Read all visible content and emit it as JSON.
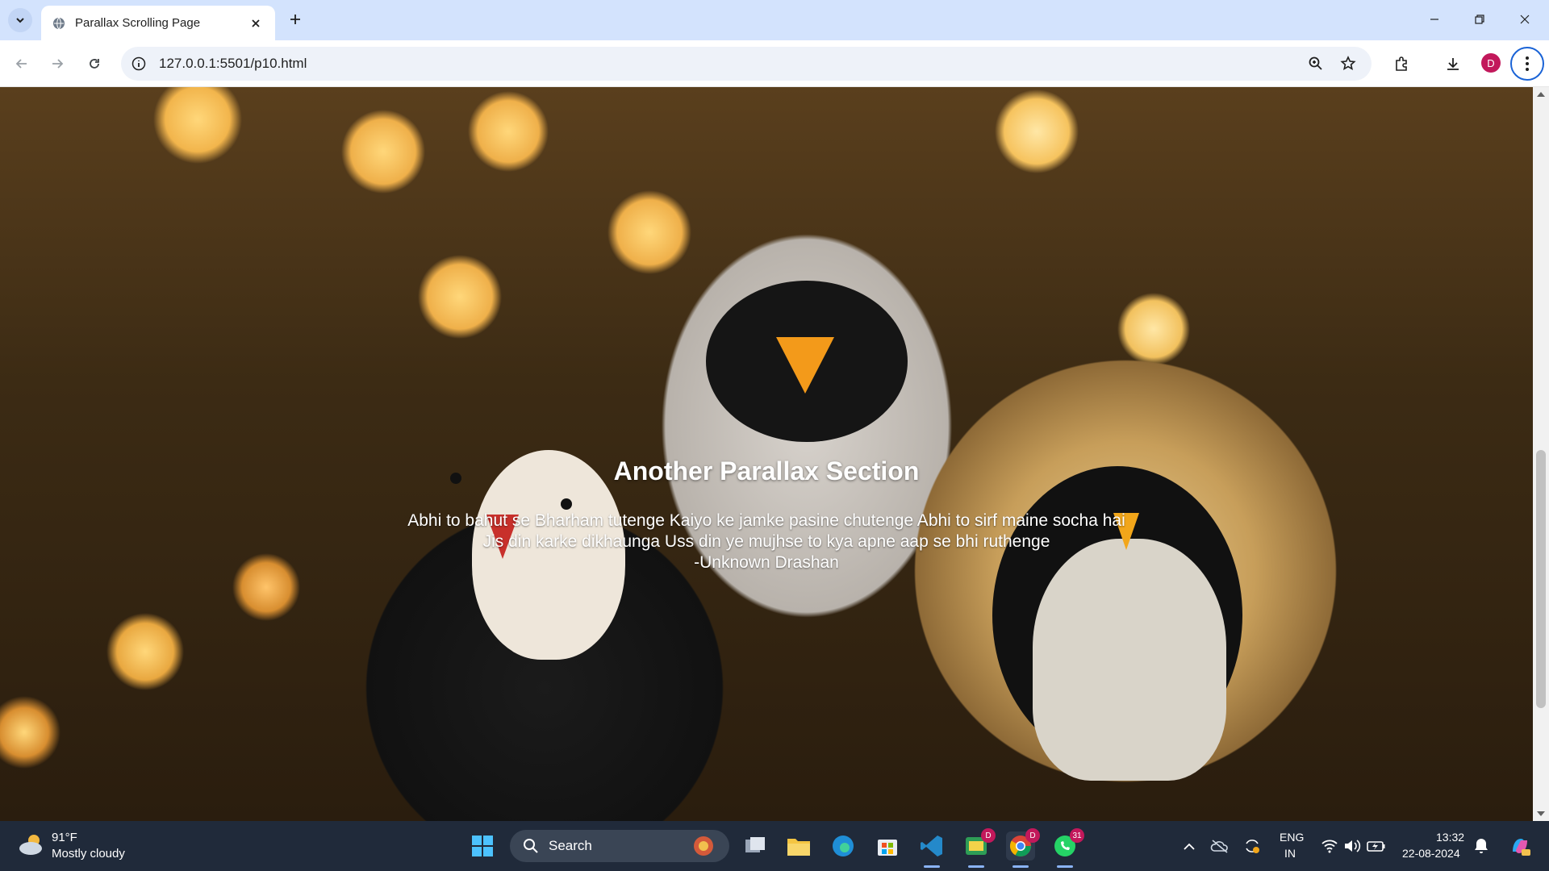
{
  "browser": {
    "tab_title": "Parallax Scrolling Page",
    "url": "127.0.0.1:5501/p10.html",
    "profile_initial": "D"
  },
  "page": {
    "section_title": "Another Parallax Section",
    "quote_lines": [
      "Abhi to bahut se Bharham tutenge Kaiyo ke jamke pasine chutenge Abhi to sirf maine socha hai",
      "Jis din karke dikhaunga Uss din ye mujhse to kya apne aap se bhi ruthenge",
      "-Unknown Drashan"
    ]
  },
  "taskbar": {
    "weather_temp": "91°F",
    "weather_desc": "Mostly cloudy",
    "search_label": "Search",
    "lang_top": "ENG",
    "lang_bottom": "IN",
    "time": "13:32",
    "date": "22-08-2024",
    "badges": {
      "app1": "D",
      "chrome": "D",
      "whatsapp": "31"
    }
  },
  "colors": {
    "accent": "#1a63d6",
    "profile": "#c2185b"
  }
}
